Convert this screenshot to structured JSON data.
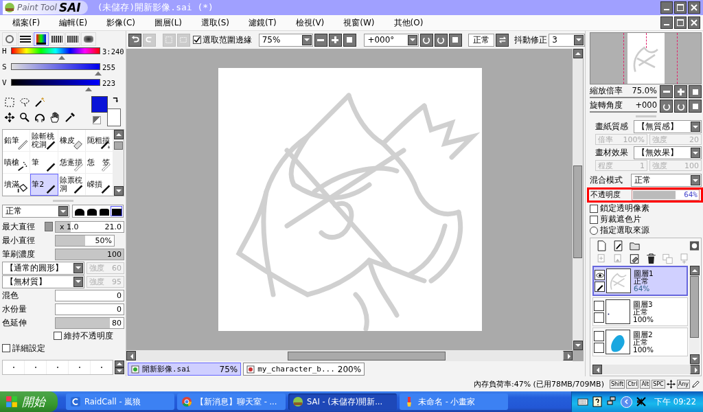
{
  "title_bar": {
    "logo_a": "Paint Tool",
    "logo_b": "SAI",
    "title": "(未儲存)開新影像.sai (*)"
  },
  "menu": [
    "檔案(F)",
    "編輯(E)",
    "影像(C)",
    "圖層(L)",
    "選取(S)",
    "濾鏡(T)",
    "檢視(V)",
    "視窗(W)",
    "其他(O)"
  ],
  "color_modes": [
    {
      "selected": false
    },
    {
      "selected": false
    },
    {
      "selected": true
    },
    {
      "selected": false
    },
    {
      "selected": false
    },
    {
      "selected": false
    }
  ],
  "hsv": [
    {
      "kind": "hue",
      "label": "H",
      "reading": "3:240",
      "level": 0.57
    },
    {
      "kind": "saturation",
      "label": "S",
      "reading": "255",
      "level": 0.98
    },
    {
      "kind": "value",
      "label": "V",
      "reading": "223",
      "level": 0.87
    }
  ],
  "tools": [
    {
      "label": "鉛筆",
      "selected": false
    },
    {
      "label": "賒斬桃梡洞",
      "selected": false
    },
    {
      "label": "橡皮",
      "selected": false
    },
    {
      "label": "阨粗摃",
      "selected": false
    },
    {
      "label": "嘖槍",
      "selected": false
    },
    {
      "label": "筆",
      "selected": false
    },
    {
      "label": "恁疐摃",
      "selected": false
    },
    {
      "label": "恁　笠",
      "selected": false
    },
    {
      "label": "墳滿",
      "selected": false
    },
    {
      "label": "筆2",
      "selected": true
    },
    {
      "label": "賒票梡洞",
      "selected": false
    },
    {
      "label": "嵘摃",
      "selected": false
    }
  ],
  "brush": {
    "mode": "正常",
    "shapes": [
      {
        "selected": false
      },
      {
        "selected": false
      },
      {
        "selected": false
      },
      {
        "selected": true
      }
    ]
  },
  "params": [
    {
      "kind": "size",
      "label": "最大直徑",
      "multiplier": "x 1.0",
      "reading": "21.0",
      "level": 0.22
    },
    {
      "kind": "slider",
      "label": "最小直徑",
      "reading": "50%",
      "level": 0.5
    },
    {
      "kind": "slider",
      "label": "筆刷濃度",
      "reading": "100",
      "level": 1
    },
    {
      "kind": "dropdown",
      "value": "【通常的圓形】",
      "strength_label": "強度",
      "strength": "60"
    },
    {
      "kind": "dropdown",
      "value": "【無材質】",
      "strength_label": "強度",
      "strength": "95"
    },
    {
      "kind": "slider",
      "label": "混色",
      "reading": "0"
    },
    {
      "kind": "slider",
      "label": "水份量",
      "reading": "0"
    },
    {
      "kind": "slider",
      "label": "色延伸",
      "reading": "80",
      "level": 0.8
    },
    {
      "kind": "sub_checkbox",
      "label": "維持不透明度",
      "checked": false
    },
    {
      "kind": "checkbox",
      "label": "詳細設定",
      "checked": false
    }
  ],
  "toolbar": {
    "selection_edge": {
      "label": "選取范圍邊緣",
      "checked": true
    },
    "zoom": "75%",
    "angle": "+000°",
    "mode_button": "正常",
    "stabilizer_label": "抖動修正",
    "stabilizer": "3"
  },
  "documents": [
    {
      "name": "開新影像.sai",
      "zoom": "75%",
      "selected": true
    },
    {
      "name": "my_character_b...",
      "zoom": "200%",
      "selected": false
    }
  ],
  "navigator": {
    "zoom_label": "縮放倍率",
    "zoom": "75.0%",
    "rotate_label": "旋轉角度",
    "rotate": "+000"
  },
  "textures": [
    {
      "label": "畫紙質感",
      "value": "【無質感】",
      "subs": [
        {
          "label": "倍率",
          "value": "100%"
        },
        {
          "label": "強度",
          "value": "20"
        }
      ]
    },
    {
      "label": "畫材效果",
      "value": "【無效果】",
      "subs": [
        {
          "label": "程度",
          "value": "1"
        },
        {
          "label": "強度",
          "value": "100"
        }
      ]
    }
  ],
  "blend": {
    "label": "混合模式",
    "value": "正常"
  },
  "opacity": {
    "label": "不透明度",
    "reading": "64%",
    "level": 0.64,
    "highlighted": true
  },
  "layer_options": [
    {
      "kind": "checkbox",
      "label": "鎖定透明像素",
      "checked": false
    },
    {
      "kind": "checkbox",
      "label": "剪裁遮色片",
      "checked": false
    },
    {
      "kind": "radio",
      "label": "指定選取來源",
      "checked": false
    }
  ],
  "layers": [
    {
      "name": "圖層1",
      "mode": "正常",
      "opacity": "64%",
      "selected": true,
      "visible": true,
      "editing": true
    },
    {
      "name": "圖層3",
      "mode": "正常",
      "opacity": "100%",
      "selected": false,
      "visible": false,
      "editing": false
    },
    {
      "name": "圖層2",
      "mode": "正常",
      "opacity": "100%",
      "selected": false,
      "visible": false,
      "editing": false
    }
  ],
  "status": {
    "memory": "內存負荷率:47% (已用78MB/709MB)",
    "keys": [
      "Shift",
      "Ctrl",
      "Alt",
      "SPC"
    ],
    "keys_after": [
      "Any"
    ]
  },
  "taskbar": {
    "start": "開始",
    "tasks": [
      {
        "label": "RaidCall - 嵐狼",
        "selected": false
      },
      {
        "label": "【新消息】聊天室 - ...",
        "selected": false
      },
      {
        "label": "SAI - (未儲存)開新...",
        "selected": true
      },
      {
        "label": "未命名 - 小畫家",
        "selected": false
      }
    ],
    "clock": "下午 09:22"
  }
}
